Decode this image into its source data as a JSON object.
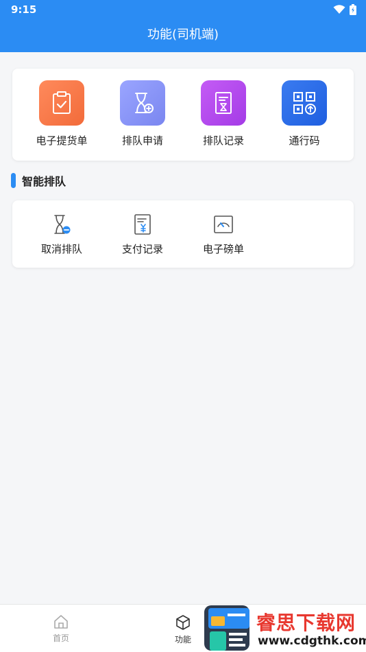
{
  "status_bar": {
    "time": "9:15"
  },
  "header": {
    "title": "功能(司机端)"
  },
  "main_features": [
    {
      "label": "电子提货单",
      "icon": "clipboard-check-icon",
      "color_from": "#ff8a5c",
      "color_to": "#f26b3a"
    },
    {
      "label": "排队申请",
      "icon": "hourglass-plus-icon",
      "color_from": "#9aa5ff",
      "color_to": "#7a86f0"
    },
    {
      "label": "排队记录",
      "icon": "queue-record-icon",
      "color_from": "#c45cf5",
      "color_to": "#a43be6"
    },
    {
      "label": "通行码",
      "icon": "pass-code-icon",
      "color_from": "#3a7bf0",
      "color_to": "#1f5fe0"
    }
  ],
  "section": {
    "title": "智能排队"
  },
  "queue_features": [
    {
      "label": "取消排队",
      "icon": "hourglass-cancel-icon"
    },
    {
      "label": "支付记录",
      "icon": "payment-record-icon"
    },
    {
      "label": "电子磅单",
      "icon": "scale-slip-icon"
    }
  ],
  "bottom_nav": {
    "items": [
      {
        "label": "首页",
        "icon": "home-icon",
        "active": false
      },
      {
        "label": "功能",
        "icon": "cube-icon",
        "active": true
      }
    ]
  },
  "watermark": {
    "title": "睿思下载网",
    "url": "www.cdgthk.com"
  },
  "colors": {
    "primary": "#2b8cf3",
    "background": "#f5f6f8",
    "text": "#222222",
    "watermark_red": "#e8382f"
  }
}
